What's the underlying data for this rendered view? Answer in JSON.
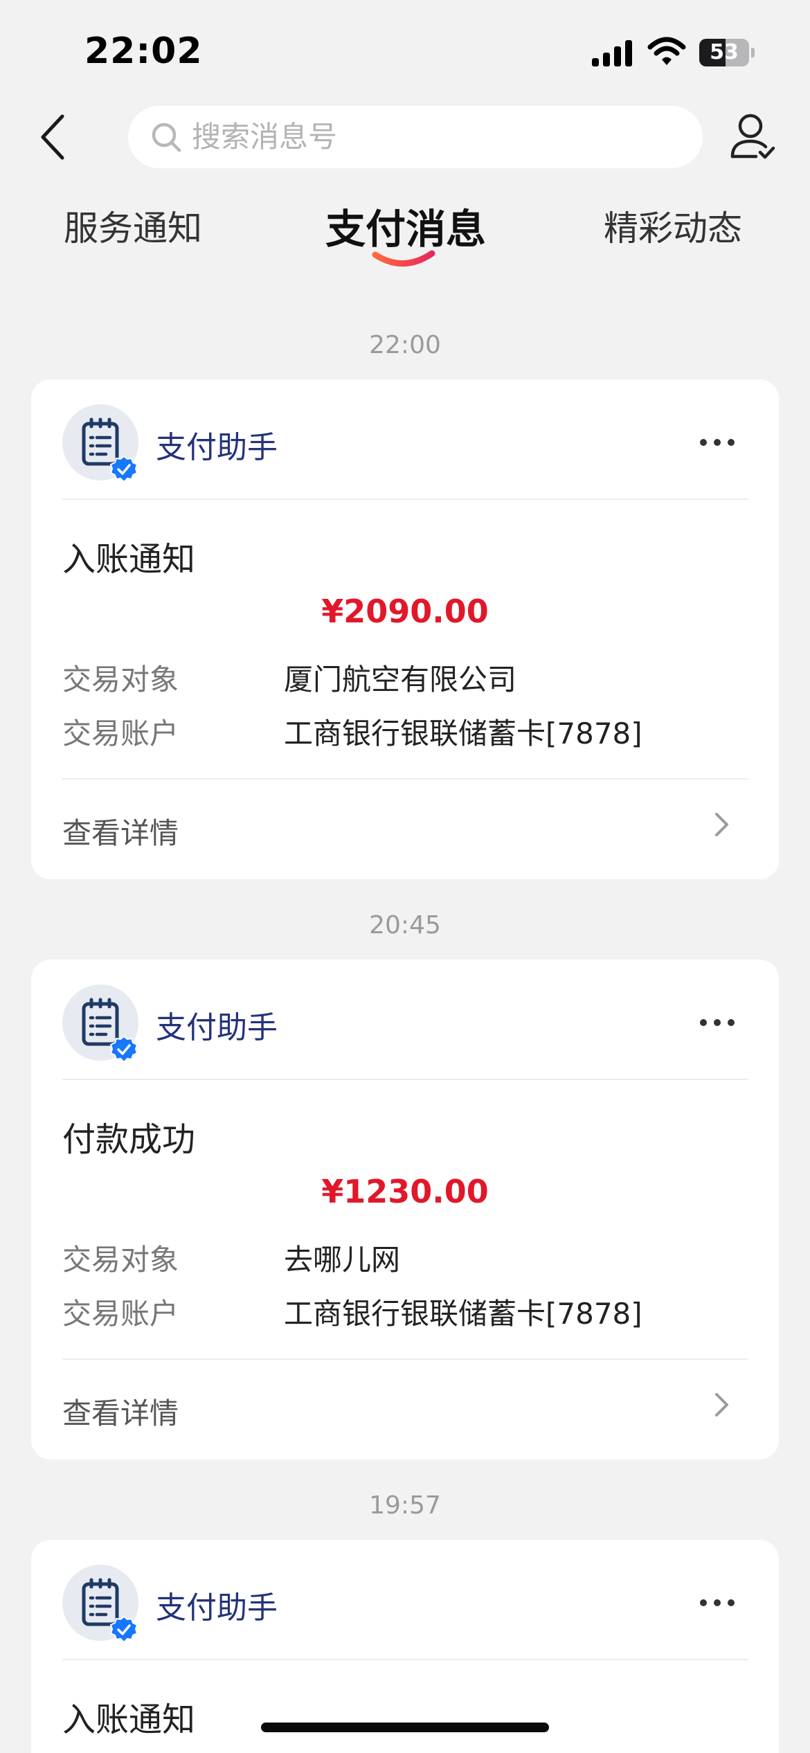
{
  "status_bar": {
    "time": "22:02",
    "battery": "53",
    "battery_level": 0.53
  },
  "header": {
    "search_placeholder": "搜索消息号"
  },
  "tabs": [
    {
      "label": "服务通知",
      "active": false
    },
    {
      "label": "支付消息",
      "active": true
    },
    {
      "label": "精彩动态",
      "active": false
    }
  ],
  "messages": [
    {
      "time": "22:00",
      "sender": "支付助手",
      "title": "入账通知",
      "amount": "¥2090.00",
      "rows": [
        {
          "label": "交易对象",
          "value": "厦门航空有限公司"
        },
        {
          "label": "交易账户",
          "value": "工商银行银联储蓄卡[7878]"
        }
      ],
      "detail_label": "查看详情"
    },
    {
      "time": "20:45",
      "sender": "支付助手",
      "title": "付款成功",
      "amount": "¥1230.00",
      "rows": [
        {
          "label": "交易对象",
          "value": "去哪儿网"
        },
        {
          "label": "交易账户",
          "value": "工商银行银联储蓄卡[7878]"
        }
      ],
      "detail_label": "查看详情"
    },
    {
      "time": "19:57",
      "sender": "支付助手",
      "title": "入账通知"
    }
  ],
  "colors": {
    "accent_red": "#e0182a",
    "sender_blue": "#23327a",
    "background": "#f2f2f3"
  }
}
